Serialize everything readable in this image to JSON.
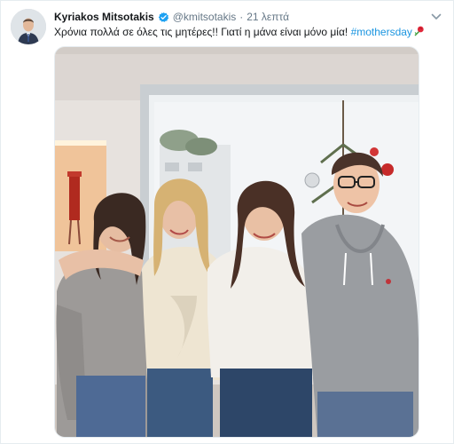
{
  "tweet": {
    "author_name": "Kyriakos Mitsotakis",
    "handle": "@kmitsotakis",
    "separator": "·",
    "time": "21 λεπτά",
    "text_before_hashtag": "Χρόνια πολλά σε όλες τις μητέρες!! Γιατί η μάνα είναι μόνο μία! ",
    "hashtag": "#mothersday",
    "emoji": "rose-emoji",
    "verified": true
  },
  "colors": {
    "link": "#1b95e0",
    "verified_badge": "#1da1f2",
    "secondary_text": "#657786",
    "primary_text": "#14171a",
    "border": "#e6ecf0"
  },
  "icons": {
    "verified": "verified-badge-icon",
    "caret": "chevron-down-icon",
    "emoji": "rose-icon"
  }
}
